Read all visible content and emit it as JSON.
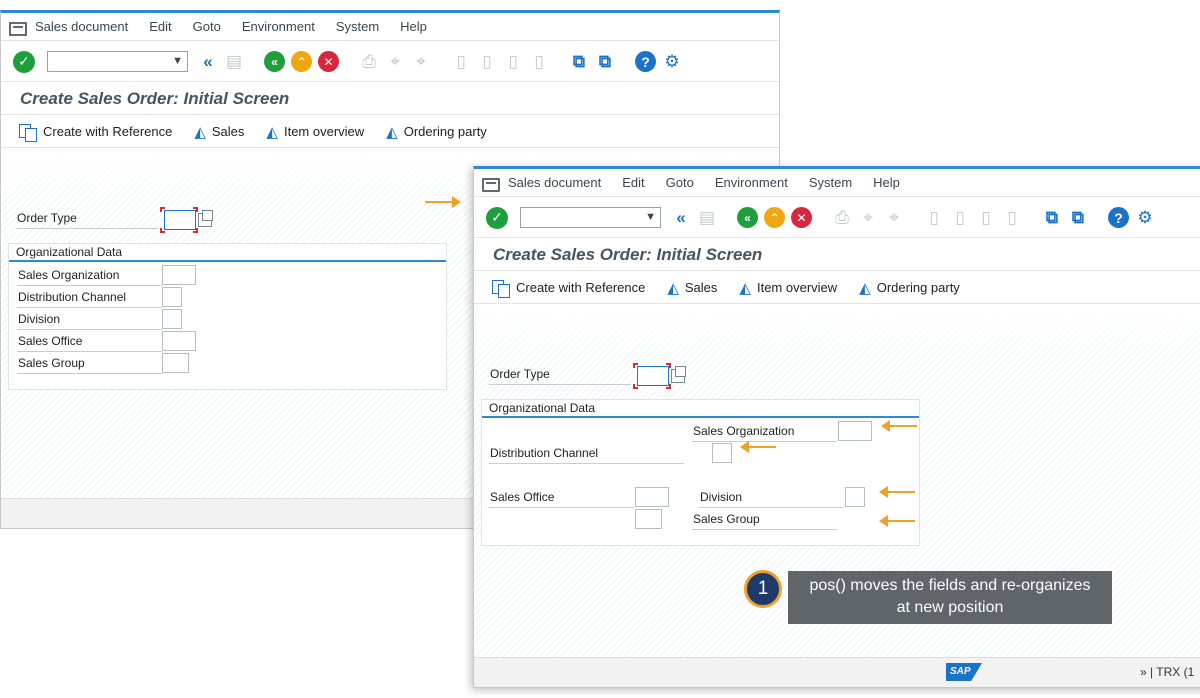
{
  "menu": [
    "Sales document",
    "Edit",
    "Goto",
    "Environment",
    "System",
    "Help"
  ],
  "screen_title": "Create Sales Order: Initial Screen",
  "app_toolbar": {
    "create_with_reference": "Create with Reference",
    "sales": "Sales",
    "item_overview": "Item overview",
    "ordering_party": "Ordering party"
  },
  "fields": {
    "order_type": "Order Type",
    "group_title": "Organizational Data",
    "sales_organization": "Sales Organization",
    "distribution_channel": "Distribution Channel",
    "division": "Division",
    "sales_office": "Sales Office",
    "sales_group": "Sales Group"
  },
  "callout": {
    "number": "1",
    "line1": "pos() moves the fields and re-organizes",
    "line2": "at new position"
  },
  "status": {
    "logo": "SAP",
    "chevrons": "»",
    "transaction": "TRX (1"
  },
  "colors": {
    "accent": "#2a8ad3",
    "arrow": "#f0a02a",
    "callout_bg": "#5f6568",
    "callout_badge": "#1d3a6b"
  },
  "icons": {
    "ok": "checkmark-icon",
    "back": "green-back-icon",
    "exit": "yellow-up-icon",
    "cancel": "red-cancel-icon",
    "help": "help-icon",
    "settings": "gear-icon"
  }
}
